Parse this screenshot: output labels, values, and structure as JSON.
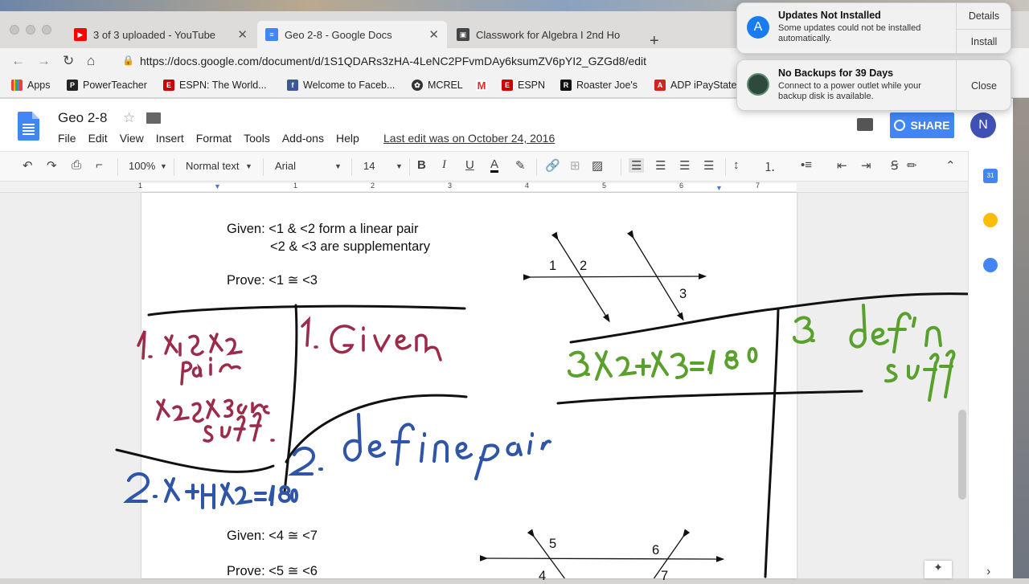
{
  "browser": {
    "tabs": [
      {
        "label": "3 of 3 uploaded - YouTube",
        "icon": "youtube-icon",
        "color": "#ff0000"
      },
      {
        "label": "Geo 2-8 - Google Docs",
        "icon": "google-docs-icon",
        "color": "#4285f4"
      },
      {
        "label": "Classwork for Algebra I 2nd Ho",
        "icon": "classroom-icon",
        "color": "#333333"
      }
    ],
    "new_tab": "+",
    "url": "https://docs.google.com/document/d/1S1QDARs3zHA-4LeNC2PFvmDAy6ksumZV6pYI2_GZGd8/edit",
    "bookmarks": [
      {
        "label": "Apps",
        "icon": "apps-grid-icon",
        "color": "#ea4335"
      },
      {
        "label": "PowerTeacher",
        "icon": "powerteacher-icon",
        "color": "#222222"
      },
      {
        "label": "ESPN: The World...",
        "icon": "espn-icon",
        "color": "#cc0000"
      },
      {
        "label": "Welcome to Faceb...",
        "icon": "facebook-icon",
        "color": "#3b5998"
      },
      {
        "label": "MCREL",
        "icon": "mcrel-icon",
        "color": "#333333"
      },
      {
        "label": "",
        "icon": "gmail-icon",
        "color": "#d93025"
      },
      {
        "label": "ESPN",
        "icon": "espn-icon",
        "color": "#cc0000"
      },
      {
        "label": "Roaster Joe's",
        "icon": "roaster-icon",
        "color": "#111111"
      },
      {
        "label": "ADP iPayState",
        "icon": "adp-icon",
        "color": "#d0271d"
      }
    ]
  },
  "docs": {
    "title": "Geo 2-8",
    "menu": [
      "File",
      "Edit",
      "View",
      "Insert",
      "Format",
      "Tools",
      "Add-ons",
      "Help"
    ],
    "last_edit": "Last edit was on October 24, 2016",
    "share_label": "SHARE",
    "avatar_initial": "N",
    "toolbar": {
      "zoom": "100%",
      "style": "Normal text",
      "font": "Arial",
      "size": "14"
    },
    "ruler_numbers": [
      "1",
      "1",
      "2",
      "3",
      "4",
      "5",
      "6",
      "7"
    ]
  },
  "document": {
    "given1_line1": "Given: <1 & <2 form a linear pair",
    "given1_line2": "<2 & <3 are supplementary",
    "prove1": "Prove: <1 ≅ <3",
    "diagram1_labels": [
      "1",
      "2",
      "3"
    ],
    "given2": "Given: <4 ≅ <7",
    "prove2": "Prove: <5 ≅ <6",
    "diagram2_labels": [
      "5",
      "6",
      "4",
      "7"
    ]
  },
  "handwriting": {
    "colors": {
      "maroon": "#9c2a4a",
      "blue": "#2f55a8",
      "green": "#5aa02c",
      "black": "#111111"
    },
    "step1_statement": "1. ∠1 & ∠2 pair ∠2&∠3 are supp.",
    "step1_reason": "1. Given",
    "step2_statement": "2. ∠1+∠2=180",
    "step2_reason": "2. def'n l. pair",
    "step3_statement": "3. ∠2+∠3=180",
    "step3_reason": "3. def'n supp"
  },
  "notifications": [
    {
      "title": "Updates Not Installed",
      "body": "Some updates could not be installed automatically.",
      "buttons": [
        "Details",
        "Install"
      ],
      "icon": "app-store-icon"
    },
    {
      "title": "No Backups for 39 Days",
      "body": "Connect to a power outlet while your backup disk is available.",
      "buttons": [
        "Close"
      ],
      "icon": "time-machine-icon"
    }
  ]
}
